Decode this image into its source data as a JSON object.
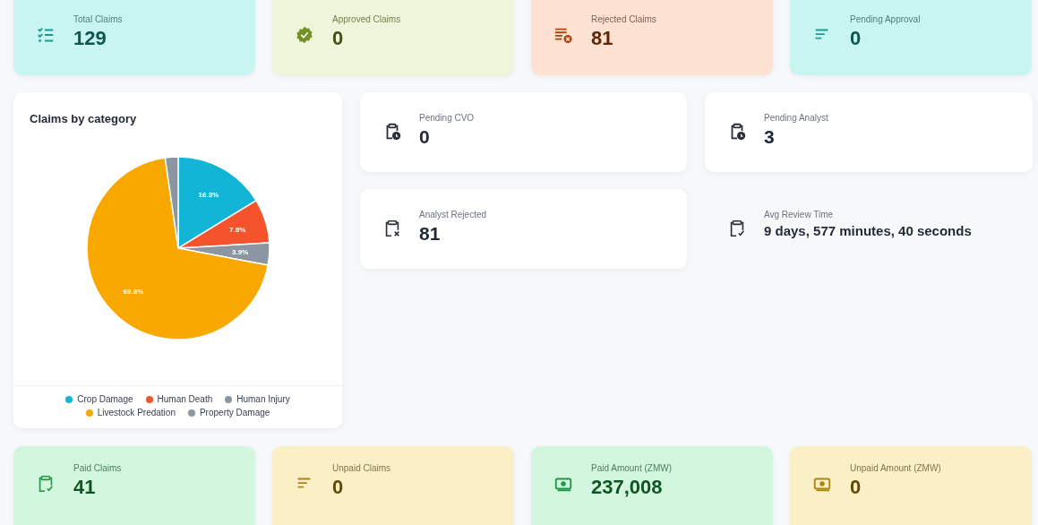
{
  "summary_cards": [
    {
      "label": "Total Claims",
      "value": "129",
      "color": "#c8f5f1"
    },
    {
      "label": "Approved Claims",
      "value": "0",
      "color": "#eef5db"
    },
    {
      "label": "Rejected Claims",
      "value": "81",
      "color": "#fde2d3"
    },
    {
      "label": "Pending Approval",
      "value": "0",
      "color": "#c8f5f1"
    }
  ],
  "category_chart": {
    "title": "Claims by category",
    "chart_data": {
      "type": "pie",
      "categories": [
        "Crop Damage",
        "Human Death",
        "Human Injury",
        "Livestock Predation",
        "Property Damage"
      ],
      "values": [
        16.3,
        7.8,
        3.9,
        69.8,
        2.3
      ],
      "legend": "bottom",
      "colors": [
        "#12b5d6",
        "#f4532b",
        "#8c96a3",
        "#f9a800",
        "#8c96a3"
      ],
      "value_labels": [
        "16.3%",
        "7.8%",
        "3.9%",
        "69.8%",
        null
      ]
    }
  },
  "review_cards": [
    {
      "label": "Pending CVO",
      "value": "0",
      "kind": "card"
    },
    {
      "label": "Pending Analyst",
      "value": "3",
      "kind": "card"
    },
    {
      "label": "Analyst Rejected",
      "value": "81",
      "kind": "card"
    },
    {
      "label": "Avg Review Time",
      "value": "9 days, 577 minutes, 40 seconds",
      "kind": "plain"
    }
  ],
  "payment_cards": [
    {
      "label": "Paid Claims",
      "value": "41",
      "color": "#d3f6de"
    },
    {
      "label": "Unpaid Claims",
      "value": "0",
      "color": "#fbefc6"
    },
    {
      "label": "Paid Amount (ZMW)",
      "value": "237,008",
      "color": "#d3f6de"
    },
    {
      "label": "Unpaid Amount (ZMW)",
      "value": "0",
      "color": "#fbefc6"
    }
  ]
}
